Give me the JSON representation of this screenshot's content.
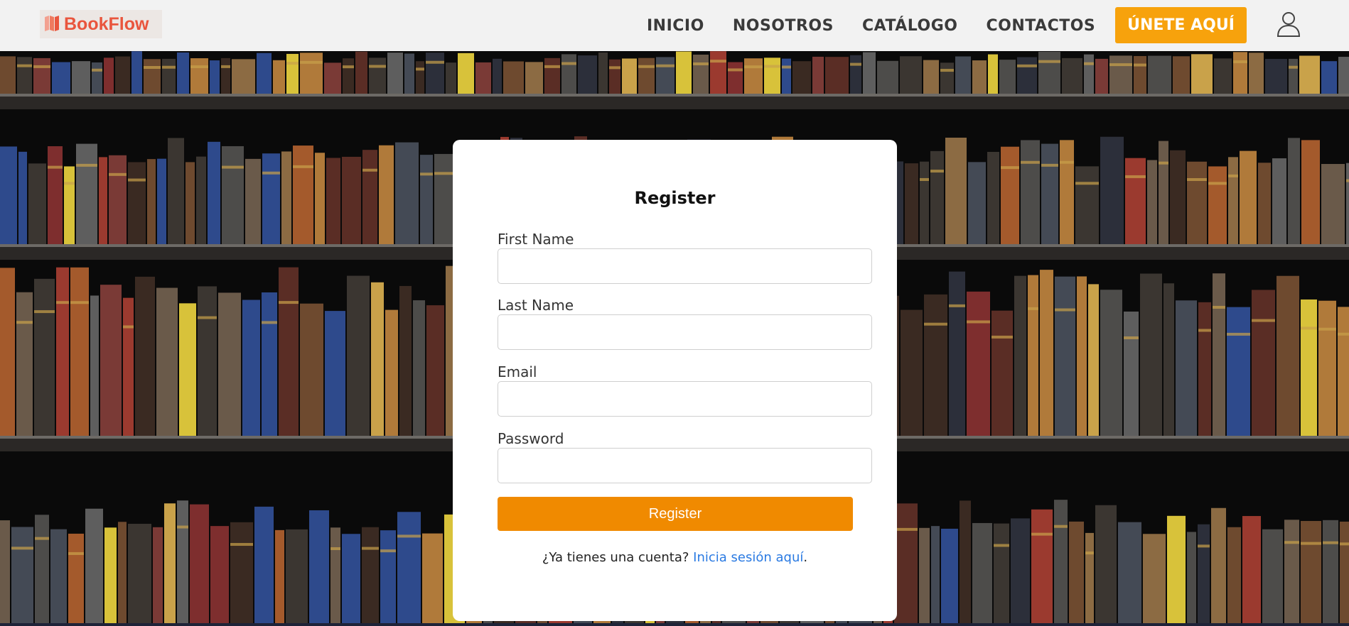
{
  "brand": {
    "name": "BookFlow",
    "color": "#e9553d"
  },
  "nav": {
    "links": [
      "INICIO",
      "NOSOTROS",
      "CATÁLOGO",
      "CONTACTOS"
    ],
    "join_label": "ÚNETE AQUÍ",
    "user_icon": "user-icon"
  },
  "form": {
    "title": "Register",
    "fields": [
      {
        "label": "First Name",
        "value": "",
        "placeholder": ""
      },
      {
        "label": "Last Name",
        "value": "",
        "placeholder": ""
      },
      {
        "label": "Email",
        "value": "",
        "placeholder": ""
      },
      {
        "label": "Password",
        "value": "",
        "placeholder": ""
      }
    ],
    "submit_label": "Register",
    "login_prompt": "¿Ya tienes una cuenta?",
    "login_link": "Inicia sesión aquí",
    "login_suffix": "."
  },
  "colors": {
    "accent": "#f7a20c",
    "button": "#f08a00",
    "link": "#2a7ae2",
    "navbar": "#f2f2f2"
  }
}
